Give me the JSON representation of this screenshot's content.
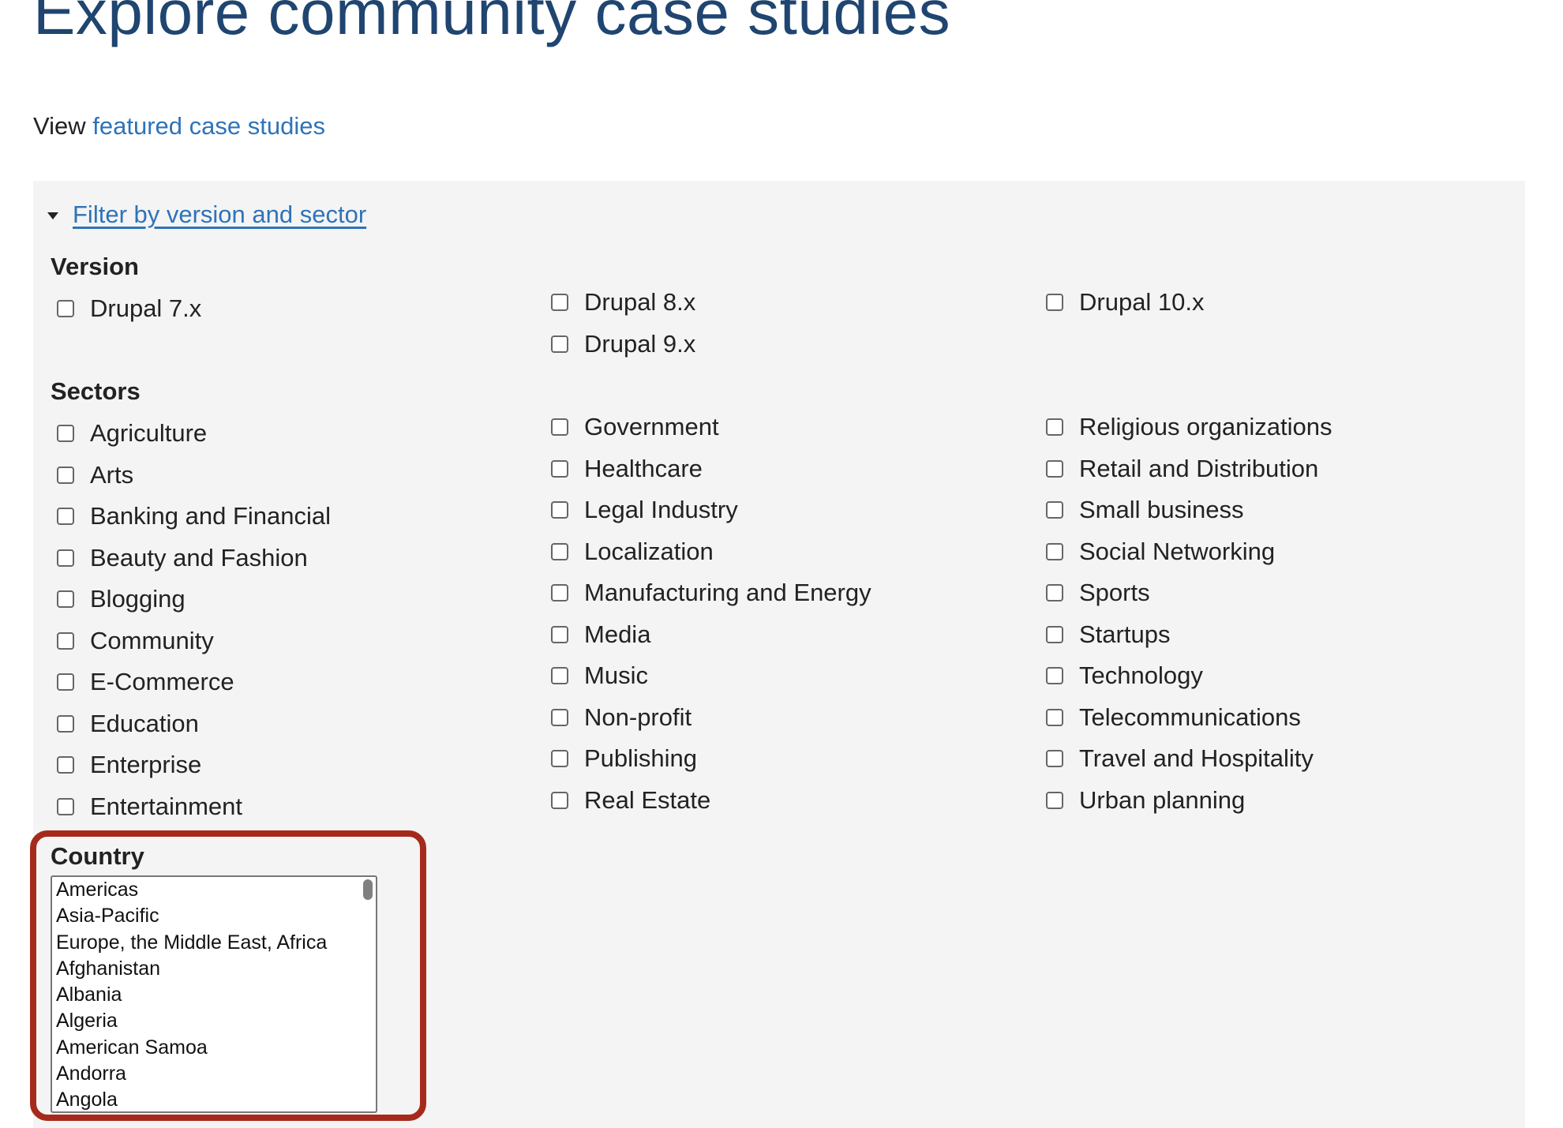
{
  "page_title": "Explore community case studies",
  "view_prefix": "View",
  "view_link": "featured case studies",
  "filter_toggle": "Filter by version and sector",
  "version": {
    "heading": "Version",
    "col1": [
      "Drupal 7.x"
    ],
    "col2": [
      "Drupal 8.x",
      "Drupal 9.x"
    ],
    "col3": [
      "Drupal 10.x"
    ]
  },
  "sectors": {
    "heading": "Sectors",
    "col1": [
      "Agriculture",
      "Arts",
      "Banking and Financial",
      "Beauty and Fashion",
      "Blogging",
      "Community",
      "E-Commerce",
      "Education",
      "Enterprise",
      "Entertainment"
    ],
    "col2": [
      "Government",
      "Healthcare",
      "Legal Industry",
      "Localization",
      "Manufacturing and Energy",
      "Media",
      "Music",
      "Non-profit",
      "Publishing",
      "Real Estate"
    ],
    "col3": [
      "Religious organizations",
      "Retail and Distribution",
      "Small business",
      "Social Networking",
      "Sports",
      "Startups",
      "Technology",
      "Telecommunications",
      "Travel and Hospitality",
      "Urban planning"
    ]
  },
  "country": {
    "heading": "Country",
    "options": [
      "Americas",
      "Asia-Pacific",
      "Europe, the Middle East, Africa",
      "Afghanistan",
      "Albania",
      "Algeria",
      "American Samoa",
      "Andorra",
      "Angola"
    ]
  },
  "colors": {
    "title": "#1f4570",
    "link": "#2f73b8",
    "panel": "#f4f4f4",
    "highlight": "#a52a1c"
  }
}
